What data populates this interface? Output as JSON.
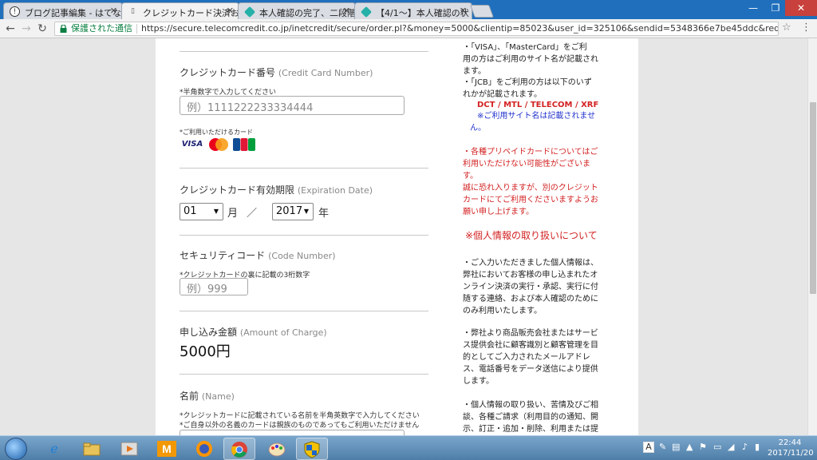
{
  "browser": {
    "tabs": [
      {
        "title": "ブログ記事編集 - はてな",
        "icon": "hatena-icon"
      },
      {
        "title": "クレジットカード決済お",
        "icon": "page-icon"
      },
      {
        "title": "本人確認の完了、二段階",
        "icon": "diamond-icon"
      },
      {
        "title": "【4/1〜】本人確認の状",
        "icon": "diamond-icon"
      }
    ],
    "secure_label": "保護された通信",
    "url": "https://secure.telecomcredit.co.jp/inetcredit/secure/order.pl?&money=5000&clientip=85023&user_id=325106&sendid=5348366e7be45ddc&redirect_ur..."
  },
  "form": {
    "card_number": {
      "label": "クレジットカード番号",
      "label_en": "(Credit Card Number)",
      "note": "*半角数字で入力してください",
      "placeholder": "例）1111222233334444",
      "cards_note": "*ご利用いただけるカード",
      "card_brands": [
        "VISA",
        "MasterCard",
        "JCB"
      ]
    },
    "expiry": {
      "label": "クレジットカード有効期限",
      "label_en": "(Expiration Date)",
      "month": "01",
      "month_unit": "月",
      "slash": "／",
      "year": "2017",
      "year_unit": "年"
    },
    "security": {
      "label": "セキュリティコード",
      "label_en": "(Code Number)",
      "note": "*クレジットカードの裏に記載の3桁数字",
      "placeholder": "例）999"
    },
    "amount": {
      "label": "申し込み金額",
      "label_en": "(Amount of Charge)",
      "value": "5000円"
    },
    "name": {
      "label": "名前",
      "label_en": "(Name)",
      "note1": "*クレジットカードに記載されている名前を半角英数字で入力してください",
      "note2": "*ご自身以外の名義のカードは親族のものであってもご利用いただけません"
    }
  },
  "side": {
    "visa_note_lines": [
      "・「VISA」、「MasterCard」をご利",
      "用の方はご利用のサイト名が記載され",
      "ます。"
    ],
    "jcb_note_lines": [
      "・「JCB」をご利用の方は以下のいず",
      "れかが記載されます。"
    ],
    "jcb_names": "DCT / MTL / TELECOM / XRF",
    "jcb_site_lines": [
      "※ご利用サイト名は記載されませ",
      "ん。"
    ],
    "prepaid_lines": [
      "・各種プリペイドカードについてはご",
      "利用いただけない可能性がございま",
      "す。",
      "誠に恐れ入りますが、別のクレジット",
      "カードにてご利用くださいますようお",
      "願い申し上げます。"
    ],
    "privacy_heading": "※個人情報の取り扱いについて",
    "privacy1_lines": [
      "・ご入力いただきました個人情報は、",
      "弊社においてお客様の申し込まれたオ",
      "ンライン決済の実行・承認、実行に付",
      "随する連絡、および本人確認のために",
      "のみ利用いたします。"
    ],
    "privacy2_lines": [
      "・弊社より商品販売会社またはサービ",
      "ス提供会社に顧客識別と顧客管理を目",
      "的としてご入力されたメールアドレ",
      "ス、電話番号をデータ送信により提供",
      "します。"
    ],
    "privacy3_lines": [
      "・個人情報の取り扱い、苦情及びご相",
      "談、各種ご請求（利用目的の通知、開",
      "示、訂正・追加・削除、利用または提"
    ]
  },
  "taskbar": {
    "time": "22:44",
    "date": "2017/11/20",
    "tray_lang": "A"
  }
}
